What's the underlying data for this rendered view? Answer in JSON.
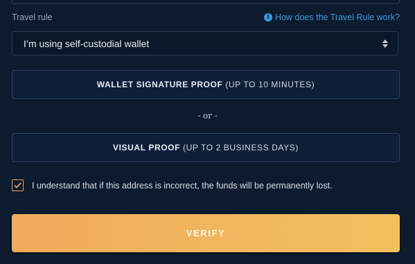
{
  "travel_rule": {
    "label": "Travel rule",
    "help_link": "How does the Travel Rule work?",
    "select_value": "I’m using self-custodial wallet"
  },
  "proofs": {
    "wallet_bold": "WALLET SIGNATURE PROOF",
    "wallet_rest": "(UP TO 10 MINUTES)",
    "or_text": "- or -",
    "visual_bold": "VISUAL PROOF",
    "visual_rest": "(UP TO 2 BUSINESS DAYS)"
  },
  "acknowledge": {
    "text": "I understand that if this address is incorrect, the funds will be permanently lost.",
    "checked": true
  },
  "verify_label": "VERIFY",
  "colors": {
    "background": "#0c1b2e",
    "accent_link": "#3a9be0",
    "checkbox": "#f1a45d",
    "verify_start": "#f0aa5c",
    "verify_end": "#f2c05f"
  }
}
